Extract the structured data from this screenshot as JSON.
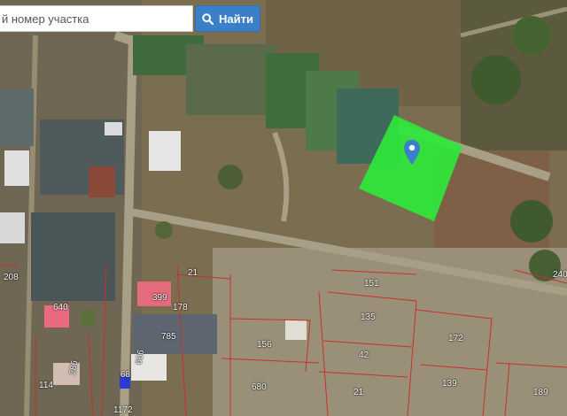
{
  "search": {
    "placeholder": "й номер участка",
    "button_label": "Найти",
    "button_icon": "search-icon"
  },
  "map": {
    "highlight_color": "#2ee83a",
    "pin_color": "#3a7fc8",
    "pin_icon": "map-pin-icon",
    "boundary_color": "#c8302a",
    "plot_labels": [
      "21",
      "208",
      "399",
      "178",
      "151",
      "640",
      "135",
      "785",
      "172",
      "156",
      "42",
      "606",
      "286",
      "68",
      "139",
      "114",
      "680",
      "21",
      "189",
      "1172",
      "240"
    ]
  }
}
